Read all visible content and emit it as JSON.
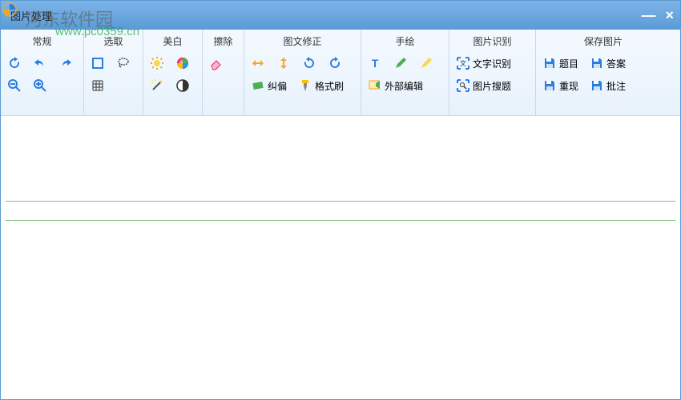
{
  "window": {
    "title": "图片处理"
  },
  "watermark": {
    "text": "河东软件园",
    "url": "www.pc0359.cn"
  },
  "groups": {
    "general": {
      "header": "常规"
    },
    "select": {
      "header": "选取"
    },
    "whiten": {
      "header": "美白"
    },
    "erase": {
      "header": "擦除"
    },
    "correct": {
      "header": "图文修正",
      "deskew": "纠偏",
      "formatbrush": "格式刷"
    },
    "hand": {
      "header": "手绘",
      "external": "外部编辑"
    },
    "ocr": {
      "header": "图片识别",
      "text": "文字识别",
      "search": "图片搜题"
    },
    "save": {
      "header": "保存图片",
      "topic": "题目",
      "answer": "答案",
      "reproduce": "重现",
      "annotate": "批注"
    }
  }
}
